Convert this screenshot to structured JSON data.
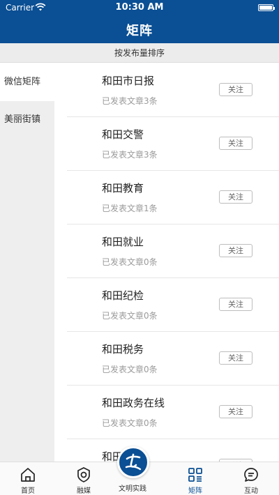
{
  "status_bar": {
    "carrier": "Carrier",
    "time": "10:30 AM"
  },
  "header": {
    "title": "矩阵"
  },
  "sort_bar": {
    "label": "按发布量排序"
  },
  "sidebar": {
    "items": [
      {
        "label": "微信矩阵",
        "active": true
      },
      {
        "label": "美丽街镇",
        "active": false
      }
    ]
  },
  "list": {
    "follow_label": "关注",
    "items": [
      {
        "name": "和田市日报",
        "sub": "已发表文章3条"
      },
      {
        "name": "和田交警",
        "sub": "已发表文章3条"
      },
      {
        "name": "和田教育",
        "sub": "已发表文章1条"
      },
      {
        "name": "和田就业",
        "sub": "已发表文章0条"
      },
      {
        "name": "和田纪检",
        "sub": "已发表文章0条"
      },
      {
        "name": "和田税务",
        "sub": "已发表文章0条"
      },
      {
        "name": "和田政务在线",
        "sub": "已发表文章0条"
      },
      {
        "name": "和田",
        "sub": ""
      }
    ]
  },
  "tabbar": {
    "items": [
      {
        "label": "首页",
        "icon": "home-icon"
      },
      {
        "label": "融媒",
        "icon": "media-icon"
      },
      {
        "label": "文明实践",
        "icon": "civilization-icon"
      },
      {
        "label": "矩阵",
        "icon": "grid-icon"
      },
      {
        "label": "互动",
        "icon": "chat-icon"
      }
    ]
  },
  "colors": {
    "brand": "#0b4f94",
    "sidebar_bg": "#eeeeee",
    "sort_bg": "#ececec"
  }
}
